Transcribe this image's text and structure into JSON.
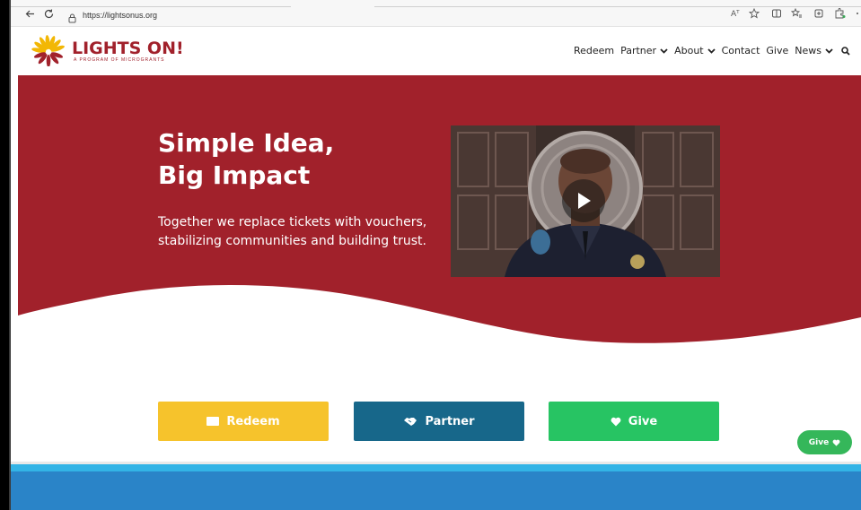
{
  "browser": {
    "url": "https://lightsonus.org",
    "back_icon": "arrow-left-icon",
    "refresh_icon": "refresh-icon",
    "lock_icon": "lock-icon",
    "toolbar_icons": [
      "read-aloud-icon",
      "favorite-star-icon",
      "split-screen-icon",
      "favorites-icon",
      "collections-icon",
      "extensions-icon",
      "more-icon"
    ],
    "read_aloud_label": "Aᵀ"
  },
  "header": {
    "logo_title": "LIGHTS ON!",
    "logo_subtitle": "A PROGRAM OF MICROGRANTS",
    "nav": [
      {
        "label": "Redeem",
        "has_dropdown": false
      },
      {
        "label": "Partner",
        "has_dropdown": true
      },
      {
        "label": "About",
        "has_dropdown": true
      },
      {
        "label": "Contact",
        "has_dropdown": false
      },
      {
        "label": "Give",
        "has_dropdown": false
      },
      {
        "label": "News",
        "has_dropdown": true
      }
    ]
  },
  "hero": {
    "title_line1": "Simple Idea,",
    "title_line2": "Big Impact",
    "text": "Together we replace tickets with vouchers, stabilizing communities and building trust."
  },
  "actions": {
    "redeem": "Redeem",
    "partner": "Partner",
    "give": "Give"
  },
  "floating_give": "Give",
  "colors": {
    "brand_red": "#a1212b",
    "logo_yellow": "#f2b705",
    "redeem_yellow": "#f6c32c",
    "partner_blue": "#17678a",
    "give_green": "#27c463",
    "footer_blue": "#2a84c8",
    "footer_light_blue": "#33b4e6"
  }
}
